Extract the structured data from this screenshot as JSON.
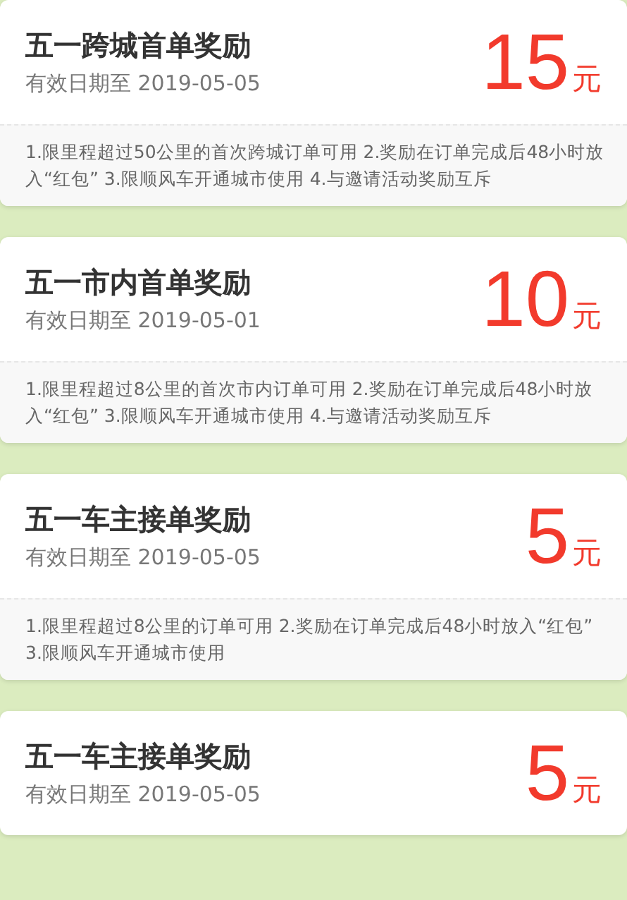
{
  "coupons": [
    {
      "title": "五一跨城首单奖励",
      "validity": "有效日期至 2019-05-05",
      "amount": "15",
      "unit": "元",
      "rules": "1.限里程超过50公里的首次跨城订单可用 2.奖励在订单完成后48小时放入“红包” 3.限顺风车开通城市使用 4.与邀请活动奖励互斥"
    },
    {
      "title": "五一市内首单奖励",
      "validity": "有效日期至 2019-05-01",
      "amount": "10",
      "unit": "元",
      "rules": "1.限里程超过8公里的首次市内订单可用 2.奖励在订单完成后48小时放入“红包” 3.限顺风车开通城市使用 4.与邀请活动奖励互斥"
    },
    {
      "title": "五一车主接单奖励",
      "validity": "有效日期至 2019-05-05",
      "amount": "5",
      "unit": "元",
      "rules": "1.限里程超过8公里的订单可用 2.奖励在订单完成后48小时放入“红包” 3.限顺风车开通城市使用"
    },
    {
      "title": "五一车主接单奖励",
      "validity": "有效日期至 2019-05-05",
      "amount": "5",
      "unit": "元"
    }
  ]
}
